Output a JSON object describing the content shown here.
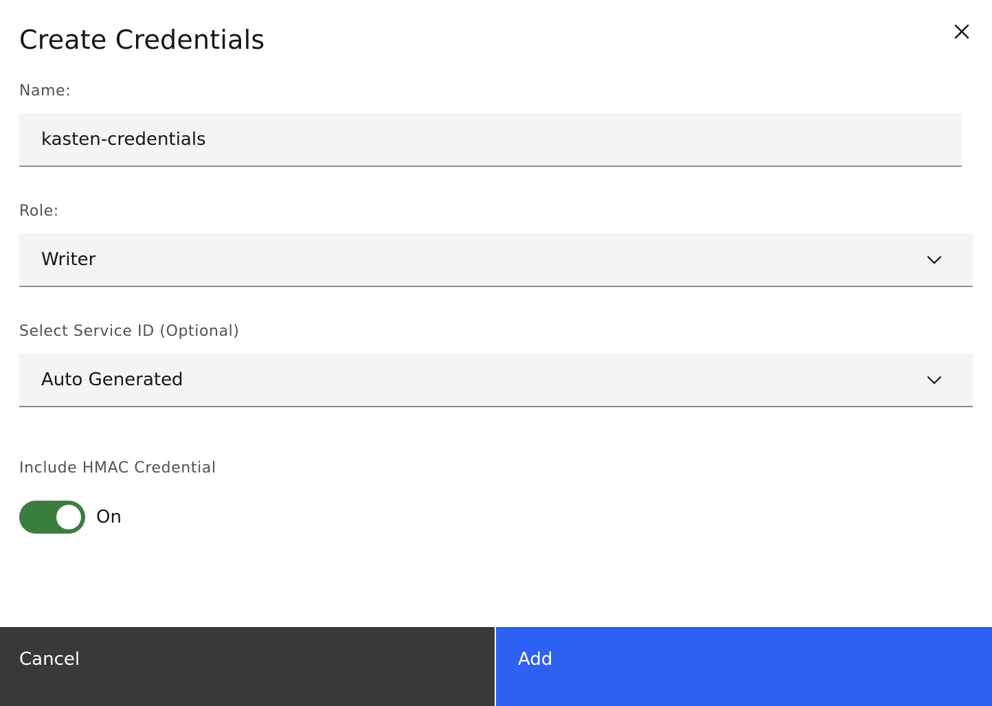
{
  "modal": {
    "title": "Create Credentials"
  },
  "form": {
    "name": {
      "label": "Name:",
      "value": "kasten-credentials"
    },
    "role": {
      "label": "Role:",
      "selected": "Writer"
    },
    "service_id": {
      "label": "Select Service ID (Optional)",
      "selected": "Auto Generated"
    },
    "hmac": {
      "label": "Include HMAC Credential",
      "state_text": "On",
      "enabled": true
    }
  },
  "footer": {
    "cancel_label": "Cancel",
    "add_label": "Add"
  },
  "colors": {
    "toggle_on": "#3b7d3f",
    "primary_button": "#2d61f3",
    "secondary_button": "#393939",
    "field_background": "#f4f4f4"
  },
  "icons": {
    "close": "close-icon",
    "dropdown": "chevron-down-icon"
  }
}
